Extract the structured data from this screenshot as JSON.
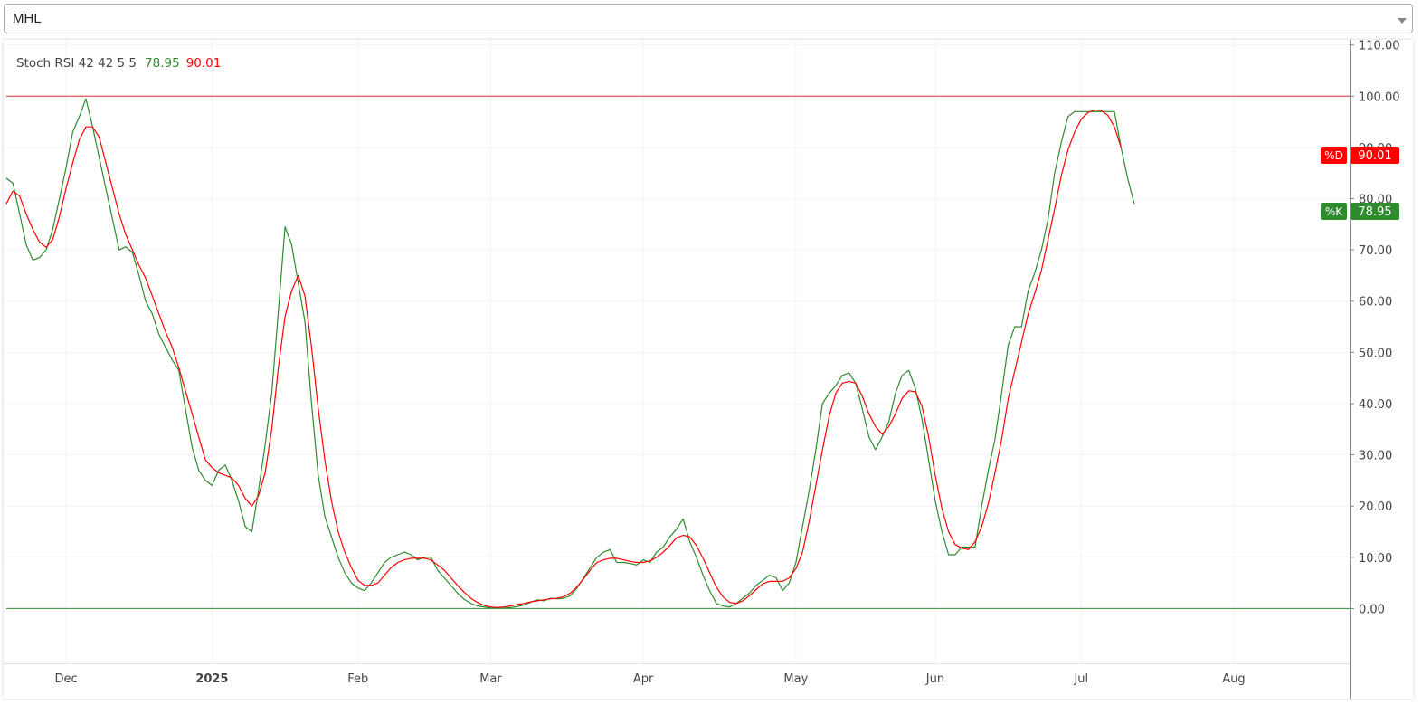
{
  "symbol_select": {
    "value": "MHL"
  },
  "legend": {
    "indicator": "Stoch RSI 42 42 5 5",
    "k_value": "78.95",
    "d_value": "90.01"
  },
  "badges": {
    "d_label": "%D",
    "d_value": "90.01",
    "k_label": "%K",
    "k_value": "78.95"
  },
  "colors": {
    "k": "#2e8b2e",
    "d": "#ff0000",
    "upper_band": "#dd3333",
    "lower_band": "#338833",
    "grid": "#f0f3fa"
  },
  "chart_data": {
    "type": "line",
    "y_ticks": [
      "110.00",
      "100.00",
      "90.00",
      "80.00",
      "70.00",
      "60.00",
      "50.00",
      "40.00",
      "30.00",
      "20.00",
      "10.00",
      "0.00"
    ],
    "y_tick_values": [
      110,
      100,
      90,
      80,
      70,
      60,
      50,
      40,
      30,
      20,
      10,
      0
    ],
    "ylim": [
      -10.7,
      111
    ],
    "bands": [
      100,
      0
    ],
    "x_ticks": [
      {
        "label": "Dec",
        "bold": false,
        "i": 9
      },
      {
        "label": "2025",
        "bold": true,
        "i": 31
      },
      {
        "label": "Feb",
        "bold": false,
        "i": 53
      },
      {
        "label": "Mar",
        "bold": false,
        "i": 73
      },
      {
        "label": "Apr",
        "bold": false,
        "i": 96
      },
      {
        "label": "May",
        "bold": false,
        "i": 119
      },
      {
        "label": "Jun",
        "bold": false,
        "i": 140
      },
      {
        "label": "Jul",
        "bold": false,
        "i": 162
      },
      {
        "label": "Aug",
        "bold": false,
        "i": 185
      }
    ],
    "x_count": 189,
    "series": [
      {
        "name": "%K",
        "color": "#2e8b2e",
        "values": [
          84,
          83,
          77,
          71,
          68,
          68.5,
          70,
          74,
          80,
          86,
          93,
          96,
          99.5,
          94,
          88,
          82,
          76,
          70,
          70.6,
          69.5,
          65,
          60,
          57.5,
          53.5,
          51,
          48.5,
          46.5,
          39,
          31.5,
          27,
          25,
          24,
          27,
          28,
          25,
          21,
          16,
          15,
          23,
          32,
          42,
          58,
          74.5,
          71,
          63.5,
          56,
          40,
          26,
          18,
          14,
          10,
          7,
          5,
          4,
          3.5,
          5,
          7,
          9,
          10,
          10.5,
          11,
          10.5,
          9.5,
          10,
          10,
          7.5,
          6,
          4.5,
          3,
          1.8,
          1,
          0.5,
          0.3,
          0.1,
          0.1,
          0.1,
          0.2,
          0.4,
          0.7,
          1.2,
          1.7,
          1.5,
          2,
          1.9,
          2,
          2.5,
          4,
          6,
          8,
          10,
          11,
          11.5,
          9,
          9,
          8.8,
          8.5,
          9.5,
          9,
          11,
          12,
          14,
          15.5,
          17.5,
          13,
          10,
          6.5,
          3.5,
          1,
          0.5,
          0.3,
          1,
          2,
          3,
          4.5,
          5.5,
          6.5,
          6,
          3.5,
          5,
          9,
          16,
          23,
          31,
          40,
          42,
          43.5,
          45.5,
          46,
          44,
          39,
          33.5,
          31,
          33.5,
          36.5,
          42,
          45.5,
          46.5,
          43,
          37,
          29,
          21,
          15,
          10.5,
          10.5,
          12,
          12,
          12,
          20,
          27,
          33,
          42,
          51.5,
          55,
          55,
          62,
          65.5,
          70,
          76,
          85,
          91,
          96,
          97,
          97,
          97,
          97,
          97,
          97,
          97,
          90,
          84,
          78.95
        ]
      },
      {
        "name": "%D",
        "color": "#ff0000",
        "values": [
          79,
          81.5,
          80.5,
          77,
          74,
          71.5,
          70.5,
          72,
          76.5,
          82,
          87,
          91.5,
          94,
          94,
          92,
          87,
          82,
          77,
          73,
          70,
          67,
          64.5,
          61,
          57.5,
          54,
          51,
          47,
          42.5,
          38,
          33.5,
          29,
          27.5,
          26.5,
          26,
          25.5,
          24,
          21.5,
          20,
          22,
          26.5,
          35,
          47,
          57,
          62,
          65,
          61,
          51,
          39,
          29,
          21,
          15,
          11,
          8,
          5.5,
          4.5,
          4.5,
          5,
          6.5,
          8,
          9,
          9.5,
          9.8,
          9.8,
          9.8,
          9.5,
          8.5,
          7.5,
          6,
          4.5,
          3.2,
          2,
          1.2,
          0.6,
          0.3,
          0.2,
          0.3,
          0.5,
          0.8,
          1,
          1.3,
          1.5,
          1.7,
          1.9,
          2,
          2.3,
          3,
          4.2,
          5.8,
          7.5,
          9,
          9.5,
          9.8,
          9.8,
          9.5,
          9.2,
          9,
          9,
          9.3,
          10,
          11,
          12.3,
          13.8,
          14.3,
          14,
          12.3,
          9.8,
          7,
          4.2,
          2.3,
          1.2,
          1,
          1.5,
          2.5,
          3.7,
          4.8,
          5.3,
          5.3,
          5.3,
          6,
          7.8,
          11,
          17,
          24,
          31,
          37.5,
          42,
          44,
          44.3,
          44,
          41.5,
          38,
          35.5,
          34,
          35.5,
          38,
          41,
          42.5,
          42.3,
          39.5,
          33.5,
          26,
          19.5,
          15,
          12.5,
          11.8,
          11.5,
          13,
          16,
          20.5,
          26.5,
          33,
          41,
          46.5,
          52,
          57.5,
          61.5,
          66,
          72,
          78,
          84.5,
          89.5,
          93,
          95.5,
          96.8,
          97.3,
          97.2,
          96.3,
          94,
          90.01
        ]
      }
    ]
  }
}
